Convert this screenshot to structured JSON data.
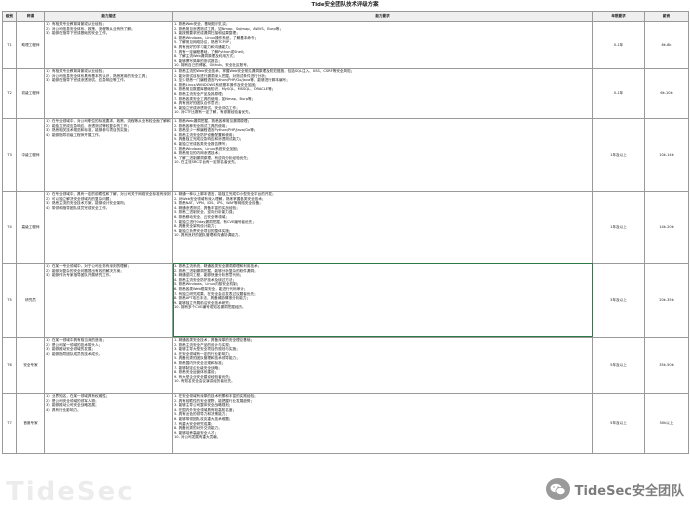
{
  "title": "Tide安全团队技术评级方案",
  "columns": [
    "级别",
    "称谓",
    "能力描述",
    "能力要求",
    "年限要求",
    "薪资"
  ],
  "rows": [
    {
      "level": "T1",
      "name": "助理工程师",
      "desc": [
        "1）有相关专业教育背景或从业经验；",
        "2）对公司信息安全体系、政策、流程等从业有所了解；",
        "3）能够在指导下完成基础的安全工作。"
      ],
      "req": [
        "1. 熟悉Web安全，基础知识扎实；",
        "2. 熟悉常见渗透测试工具，如Nmap、Sqlmap、AWVS、Burp等；",
        "3. 能按照要求完成漏洞扫描和结果整理；",
        "4. 熟悉Windows、Linux操作系统，了解基本命令；",
        "5. 了解常见网络协议，熟悉TCP/IP；",
        "6. 具有良好的学习能力和沟通能力；",
        "7. 具有一定编程基础，了解Python或Shell；",
        "8. 了解主流Web漏洞原理及利用方式；",
        "9. 能够撰写简单的测试报告；",
        "10. 拥有自己的博客、Github、安全社区账号。"
      ],
      "years": "0-1年",
      "salary": "6k-8k"
    },
    {
      "level": "T2",
      "name": "初级工程师",
      "desc": [
        "1）有相关专业教育背景或从业经验；",
        "2）对公司信息安全体系具有基本的认识，熟悉常用的安全工具；",
        "3）能够在指导下完成渗透测试、应急响应等工作。"
      ],
      "req": [
        "1. 熟悉主流的Web安全技术，掌握Web安全常见漏洞原理及防范措施，包括SQL注入、XSS、CSRF等安全风险；",
        "2. 能对测试目标进行漏洞深入挖掘，对测试条件进行分析；",
        "3. 至少熟悉一门编程语言Python/PHP/Go/Java等，能够进行脚本编写；",
        "4. 熟悉Linux/WINDOWS系统基本操作及安全加固；",
        "5. 熟悉常见数据库基础知识，MySQL、MSSQL、ORACLE等；",
        "6. 熟悉主流安全产品及其原理；",
        "7. 熟悉各类安全工具的使用，如Nmap、Burp等；",
        "8. 具有良好的团队合作意识；",
        "9. 能独立完成渗透测试、安全评估工作；",
        "10. 对CTF比赛有一定了解，有参赛经验者优先。"
      ],
      "years": "0-1年",
      "salary": "6k-10k"
    },
    {
      "level": "T3",
      "name": "中级工程师",
      "desc": [
        "1）在专业领域中，对公司职位的标准要求、政策、流程等从业有较全面了解和实际操作经验；",
        "2）能独立完成应急响应、渗透测试等较复杂的工作；",
        "3）熟悉相关技术规范和标准，能够参与项目的实施；",
        "4）能够指导初级工程师开展工作。"
      ],
      "req": [
        "1. 熟悉Web漏洞挖掘，熟悉各种常见漏洞原理；",
        "2. 熟悉各种安全测试工具的使用；",
        "3. 熟悉至少一种编程语言Python/PHP/Java/Go等；",
        "4. 熟悉主流安全防护设备配置和使用；",
        "5. 具备独立完成应急响应和渗透测试能力；",
        "6. 能独立完成各类安全报告撰写；",
        "7. 熟悉Windows、Linux系统安全加固；",
        "8. 熟悉常见的内网渗透技术；",
        "9. 了解二进制漏洞原理，有逆向分析经验优先；",
        "10. 在主流SRC平台有一定排名者优先。"
      ],
      "years": "1年及以上",
      "salary": "10k-14k"
    },
    {
      "level": "T4",
      "name": "高级工程师",
      "desc": [
        "1）在专业领域中，具有一定的前瞻性和了解，对公司关于网络安全标准有深刻理解；",
        "2）可以独立解决安全领域内的复杂问题；",
        "3）熟悉主流的安全技术方案，能够设计安全架构；",
        "4）带领和指导团队成员完成安全工作。"
      ],
      "req": [
        "1. 精通一种以上脚本语言，能独立完成中小型安全平台的开发；",
        "2. 对Web安全领域有深入理解，熟练掌握各类安全技术；",
        "3. 熟悉NAT、VPN、IDS、IPS、WAF等网络安全设备；",
        "4. 精通渗透测试，具备丰富的实战经验；",
        "5. 熟悉二进制安全，逆向分析能力强；",
        "6. 熟悉移动安全、云安全等领域；",
        "7. 能独立进行0day漏洞挖掘，有CVE编号者优先；",
        "8. 具备安全架构设计能力；",
        "9. 能独立负责安全项目的整体实施；",
        "10. 具有良好的团队管理和沟通协调能力。"
      ],
      "years": "1年及以上",
      "salary": "14k-20k"
    },
    {
      "level": "T5",
      "name": "研究员",
      "desc": [
        "1）在某一专业领域中，对于公司业务有深刻的理解；",
        "2）能够对复杂的安全问题提出有效的解决方案；",
        "3）能够作为专家指导团队开展研究工作。"
      ],
      "req": [
        "1. 熟悉主流系统，精通各类安全漏洞原理和利用技术；",
        "2. 熟悉二进制漏洞挖掘，能够分析复杂的软件漏洞；",
        "3. 精通逆向工程，能够快速分析恶意代码；",
        "4. 熟悉主流安全防护技术及绕过方法；",
        "5. 熟悉Windows、Linux内核安全机制；",
        "6. 熟悉各类Web框架安全，能进行代码审计；",
        "7. 有独立研究成果，在安全会议发表过议题者优先；",
        "8. 熟悉APT攻击手法，具备威胁情报分析能力；",
        "9. 能够独立开展前沿安全技术研究；",
        "10. 拥有多个CVE编号或知名漏洞挖掘经历。"
      ],
      "years": "3年及以上",
      "salary": "20k-35k"
    },
    {
      "level": "T6",
      "name": "安全专家",
      "desc": [
        "1）在某一领域中具有相当深的造诣；",
        "2）是公司某一领域的技术带头人；",
        "3）能够推动安全领域的发展；",
        "4）能够指导团队成员的技术成长。"
      ],
      "req": [
        "1. 精通各类安全技术，具备深厚的安全理论基础；",
        "2. 熟悉主流安全产品的设计与实现；",
        "3. 能够主导大型安全项目的规划与实施；",
        "4. 在安全领域有一定的行业影响力；",
        "5. 具备优秀的团队管理和技术领导能力；",
        "6. 熟悉国内外安全法规和标准；",
        "7. 能够制定企业级安全战略；",
        "8. 熟悉安全运营体系建设；",
        "9. 有大型企业安全建设经验者优先；",
        "10. 有知名安全会议演讲经历者优先。"
      ],
      "years": "5年及以上",
      "salary": "35k-50k"
    },
    {
      "level": "T7",
      "name": "首席专家",
      "desc": [
        "1）业界知名，在某一领域具有权威性；",
        "2）是公司安全领域的领军人物；",
        "3）能够推动公司安全战略发展；",
        "4）具有行业影响力。"
      ],
      "req": [
        "1. 在安全领域有深厚的技术积累和丰富的实践经验；",
        "2. 具有前瞻性的安全视野，能把握行业发展趋势；",
        "3. 能够主导公司整体安全战略规划；",
        "4. 在国内外安全领域具有较高知名度；",
        "5. 具有出色的领导力和决策能力；",
        "6. 能够带领团队攻克重大技术难题；",
        "7. 有重大安全研究成果；",
        "8. 具备优秀的对外交流能力；",
        "9. 能够培养高级安全人才；",
        "10. 对公司发展有重大贡献。"
      ],
      "years": "5年及以上",
      "salary": "50k以上"
    }
  ],
  "watermark": {
    "label": "TideSec安全团队",
    "icon": "wechat-icon",
    "bg_mark": "TideSec"
  }
}
